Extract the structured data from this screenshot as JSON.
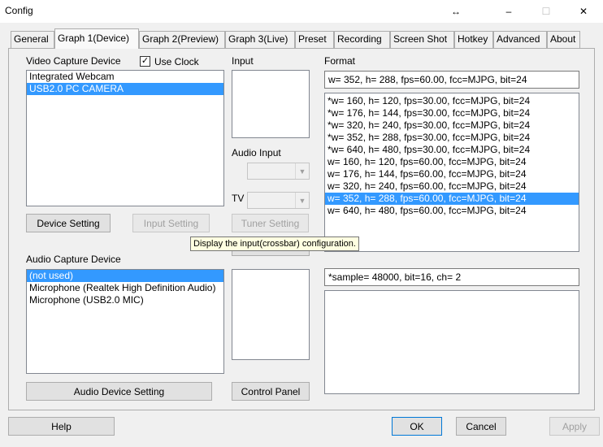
{
  "window": {
    "title": "Config",
    "resize_glyph": "↔",
    "minimize_glyph": "–",
    "maximize_glyph": "☐",
    "close_glyph": "✕"
  },
  "tabs": [
    {
      "label": "General"
    },
    {
      "label": "Graph 1(Device)",
      "active": true
    },
    {
      "label": "Graph 2(Preview)"
    },
    {
      "label": "Graph 3(Live)"
    },
    {
      "label": "Preset"
    },
    {
      "label": "Recording"
    },
    {
      "label": "Screen Shot"
    },
    {
      "label": "Hotkey"
    },
    {
      "label": "Advanced"
    },
    {
      "label": "About"
    }
  ],
  "video": {
    "label": "Video Capture Device",
    "use_clock_label": "Use Clock",
    "use_clock_checked": true,
    "use_clock_check_glyph": "✓",
    "devices": [
      {
        "name": "Integrated Webcam",
        "selected": false
      },
      {
        "name": "USB2.0 PC CAMERA",
        "selected": true
      }
    ],
    "device_setting_label": "Device Setting",
    "input_setting_label": "Input Setting",
    "tuner_setting_label": "Tuner Setting"
  },
  "input": {
    "label": "Input",
    "audio_input_label": "Audio Input",
    "tv_label": "TV",
    "combo_arrow": "▼"
  },
  "tooltip": "Display the input(crossbar) configuration.",
  "format": {
    "label": "Format",
    "current": "w= 352, h= 288, fps=60.00,  fcc=MJPG, bit=24",
    "items": [
      {
        "text": "*w= 160, h= 120, fps=30.00,  fcc=MJPG, bit=24",
        "selected": false
      },
      {
        "text": "*w= 176, h= 144, fps=30.00,  fcc=MJPG, bit=24",
        "selected": false
      },
      {
        "text": "*w= 320, h= 240, fps=30.00,  fcc=MJPG, bit=24",
        "selected": false
      },
      {
        "text": "*w= 352, h= 288, fps=30.00,  fcc=MJPG, bit=24",
        "selected": false
      },
      {
        "text": "*w= 640, h= 480, fps=30.00,  fcc=MJPG, bit=24",
        "selected": false
      },
      {
        "text": "w= 160, h= 120, fps=60.00,  fcc=MJPG, bit=24",
        "selected": false
      },
      {
        "text": "w= 176, h= 144, fps=60.00,  fcc=MJPG, bit=24",
        "selected": false
      },
      {
        "text": "w= 320, h= 240, fps=60.00,  fcc=MJPG, bit=24",
        "selected": false
      },
      {
        "text": "w= 352, h= 288, fps=60.00,  fcc=MJPG, bit=24",
        "selected": true
      },
      {
        "text": "w= 640, h= 480, fps=60.00,  fcc=MJPG, bit=24",
        "selected": false
      }
    ]
  },
  "audio": {
    "label": "Audio Capture Device",
    "devices": [
      {
        "name": "(not used)",
        "selected": true
      },
      {
        "name": "Microphone (Realtek High Definition Audio)",
        "selected": false
      },
      {
        "name": "Microphone (USB2.0 MIC)",
        "selected": false
      }
    ],
    "audio_device_setting_label": "Audio Device Setting",
    "control_panel_label": "Control Panel",
    "format_current": "*sample= 48000, bit=16, ch= 2"
  },
  "footer": {
    "help_label": "Help",
    "ok_label": "OK",
    "cancel_label": "Cancel",
    "apply_label": "Apply"
  },
  "colors": {
    "selection": "#3399ff",
    "tooltip_bg": "#ffffe1"
  }
}
